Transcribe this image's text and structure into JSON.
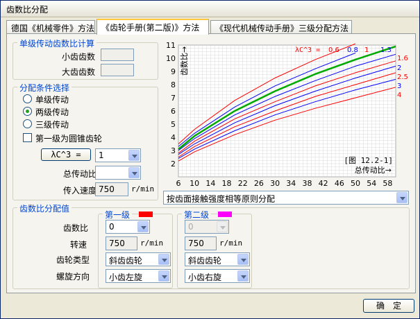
{
  "window": {
    "title": "齿数比分配"
  },
  "tabs": [
    {
      "label": "德国《机械零件》方法"
    },
    {
      "label": "《齿轮手册(第二版)》方法"
    },
    {
      "label": "《现代机械传动手册》三级分配方法"
    }
  ],
  "single": {
    "title": "单级传动齿数比计算",
    "small_label": "小齿齿数",
    "large_label": "大齿齿数"
  },
  "cond": {
    "title": "分配条件选择",
    "opt1": "单级传动",
    "opt2": "两级传动",
    "opt3": "三级传动",
    "bevel": "第一级为圆锥齿轮",
    "lc3_btn": "λC^3 =",
    "lc3_val": "1",
    "total_label": "总传动比",
    "speed_label": "传入速度",
    "speed_val": "750",
    "speed_unit": "r/min"
  },
  "method": {
    "selected": "按齿面接触强度相等原则分配"
  },
  "dist": {
    "title": "齿数比分配值",
    "stage1": "第一级",
    "stage2": "第二级",
    "ratio_label": "齿数比",
    "speed_label": "转速",
    "type_label": "齿轮类型",
    "helix_label": "螺旋方向",
    "s1_ratio": "0",
    "s2_ratio": "0",
    "s1_speed": "750",
    "s2_speed": "750",
    "unit": "r/min",
    "s1_type": "斜齿齿轮",
    "s2_type": "斜齿齿轮",
    "s1_helix": "小齿左旋",
    "s2_helix": "小齿右旋",
    "s1_color": "#ff0000",
    "s2_color": "#ff00ff"
  },
  "ok_label": "确　定",
  "chart_data": {
    "type": "line",
    "ylabel": "齿数比",
    "xlabel": "总传动比→",
    "fig_ref": "[图 12.2-1]",
    "legend_title": "λC^3 =",
    "x_ticks": [
      6,
      10,
      14,
      18,
      22,
      26,
      30,
      34,
      38,
      42,
      46,
      50,
      54,
      58
    ],
    "y_ticks": [
      2,
      3,
      4,
      5,
      6,
      7,
      8,
      9,
      10,
      11
    ],
    "xlim": [
      6,
      60
    ],
    "ylim": [
      1,
      11
    ],
    "curve_labels": [
      "0.6",
      "0.8",
      "1",
      "1.3",
      "1.6",
      "2",
      "2.5",
      "3",
      "4"
    ],
    "series": [
      {
        "name": "0.6",
        "color": "#ff0000",
        "x": [
          6,
          10,
          20,
          30,
          40,
          50,
          55
        ],
        "y": [
          3.5,
          4.6,
          6.8,
          8.5,
          9.9,
          11.1,
          11.7
        ]
      },
      {
        "name": "0.8",
        "color": "#0000ff",
        "x": [
          6,
          10,
          20,
          30,
          40,
          50,
          60
        ],
        "y": [
          3.3,
          4.3,
          6.3,
          7.9,
          9.2,
          10.4,
          11.4
        ]
      },
      {
        "name": "1",
        "color": "#00aa00",
        "x": [
          6,
          10,
          20,
          30,
          40,
          50,
          60
        ],
        "y": [
          3.1,
          4.1,
          6.0,
          7.5,
          8.8,
          9.9,
          10.9
        ]
      },
      {
        "name": "1.3",
        "color": "#0000ff",
        "x": [
          6,
          10,
          20,
          30,
          40,
          50,
          60
        ],
        "y": [
          3.0,
          3.9,
          5.7,
          7.1,
          8.3,
          9.4,
          10.3
        ]
      },
      {
        "name": "1.6",
        "color": "#ff0000",
        "x": [
          6,
          10,
          20,
          30,
          40,
          50,
          60
        ],
        "y": [
          2.8,
          3.7,
          5.4,
          6.7,
          7.9,
          8.9,
          9.8
        ]
      },
      {
        "name": "2",
        "color": "#0000ff",
        "x": [
          6,
          10,
          20,
          30,
          40,
          50,
          60
        ],
        "y": [
          2.7,
          3.5,
          5.1,
          6.4,
          7.5,
          8.5,
          9.4
        ]
      },
      {
        "name": "2.5",
        "color": "#ff0000",
        "x": [
          6,
          10,
          20,
          30,
          40,
          50,
          60
        ],
        "y": [
          2.5,
          3.3,
          4.8,
          6.0,
          7.1,
          8.0,
          8.9
        ]
      },
      {
        "name": "3",
        "color": "#0000ff",
        "x": [
          6,
          10,
          20,
          30,
          40,
          50,
          60
        ],
        "y": [
          2.4,
          3.1,
          4.5,
          5.7,
          6.7,
          7.6,
          8.4
        ]
      },
      {
        "name": "4",
        "color": "#ff0000",
        "x": [
          6,
          10,
          20,
          30,
          40,
          50,
          60
        ],
        "y": [
          2.2,
          2.9,
          4.2,
          5.3,
          6.2,
          7.0,
          7.8
        ]
      }
    ]
  }
}
